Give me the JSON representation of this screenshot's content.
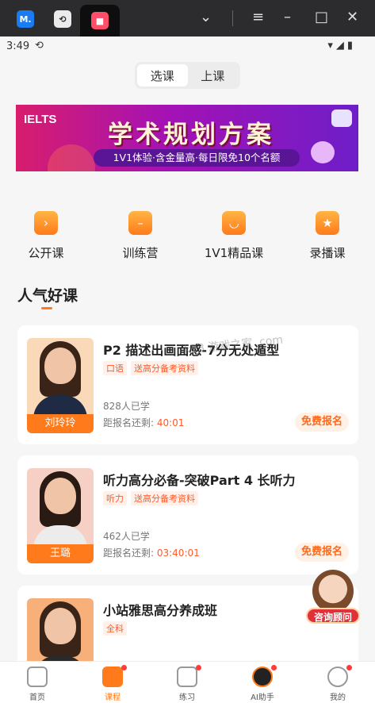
{
  "emulator_bar": {
    "tabs": [
      {
        "icon": "app-icon-blue",
        "glyph": "M."
      },
      {
        "icon": "app-icon-sync",
        "glyph": "⟲"
      },
      {
        "icon": "app-icon-active",
        "glyph": "■"
      }
    ],
    "controls": [
      "⌄",
      "≡",
      "–",
      "□",
      "✕"
    ]
  },
  "status_bar": {
    "time": "3:49",
    "sync_glyph": "⟲",
    "wifi": "▾",
    "signal": "◢",
    "battery": "▮"
  },
  "segment": {
    "options": [
      "选课",
      "上课"
    ],
    "selected": 0
  },
  "banner": {
    "logo": "IELTS",
    "title": "学术规划方案",
    "subtitle": "1V1体验·含金量高·每日限免10个名额"
  },
  "categories": [
    {
      "label": "公开课",
      "icon": "play-icon",
      "glyph": "›"
    },
    {
      "label": "训练营",
      "icon": "clipboard-icon",
      "glyph": "–"
    },
    {
      "label": "1V1精品课",
      "icon": "chat-icon",
      "glyph": "◡"
    },
    {
      "label": "录播课",
      "icon": "star-icon",
      "glyph": "★"
    }
  ],
  "section": {
    "title": "人气好课"
  },
  "courses": [
    {
      "title": "P2 描述出画面感-7分无处遁型",
      "tags": [
        "口语",
        "送高分备考资料"
      ],
      "teacher": "刘玲玲",
      "learned": "828人已学",
      "remain_label": "距报名还剩: ",
      "countdown": "40:01",
      "button": "免费报名"
    },
    {
      "title": "听力高分必备-突破Part 4 长听力",
      "tags": [
        "听力",
        "送高分备考资料"
      ],
      "teacher": "王璐",
      "learned": "462人已学",
      "remain_label": "距报名还剩: ",
      "countdown": "03:40:01",
      "button": "免费报名"
    },
    {
      "title": "小站雅思高分养成班",
      "tags": [
        "全科"
      ]
    }
  ],
  "watermark": "k73 游戏之家 .com",
  "consult": {
    "label": "咨询顾问"
  },
  "bottom_nav": [
    {
      "label": "首页",
      "icon": "home-icon",
      "active": false,
      "badge": false
    },
    {
      "label": "课程",
      "icon": "course-icon",
      "active": true,
      "badge": true
    },
    {
      "label": "练习",
      "icon": "book-icon",
      "active": false,
      "badge": true
    },
    {
      "label": "AI助手",
      "icon": "robot-icon",
      "active": false,
      "badge": true
    },
    {
      "label": "我的",
      "icon": "profile-icon",
      "active": false,
      "badge": true
    }
  ],
  "colors": {
    "accent": "#ff7a1a",
    "countdown": "#ff5a2a",
    "consult": "#e0303a"
  }
}
